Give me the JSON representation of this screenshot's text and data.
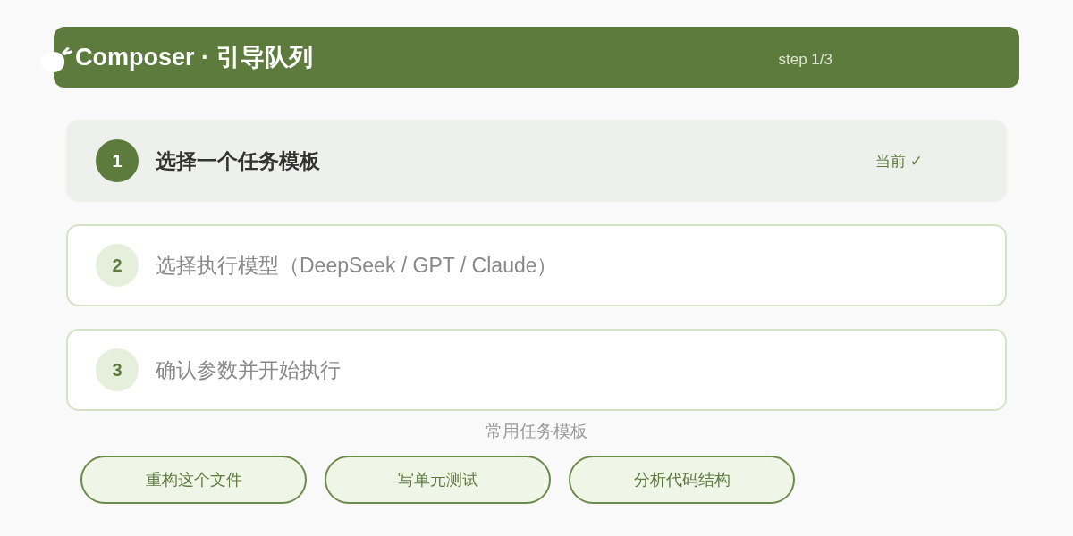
{
  "header": {
    "title": "Composer · 引导队列",
    "step": "step 1/3"
  },
  "steps": [
    {
      "number": "1",
      "label": "选择一个任务模板",
      "selected": true,
      "badge": "当前 ✓"
    },
    {
      "number": "2",
      "label": "选择执行模型（DeepSeek / GPT / Claude）",
      "selected": false
    },
    {
      "number": "3",
      "label": "确认参数并开始执行",
      "selected": false
    }
  ],
  "templates": {
    "title": "常用任务模板",
    "buttons": [
      "重构这个文件",
      "写单元测试",
      "分析代码结构"
    ]
  }
}
